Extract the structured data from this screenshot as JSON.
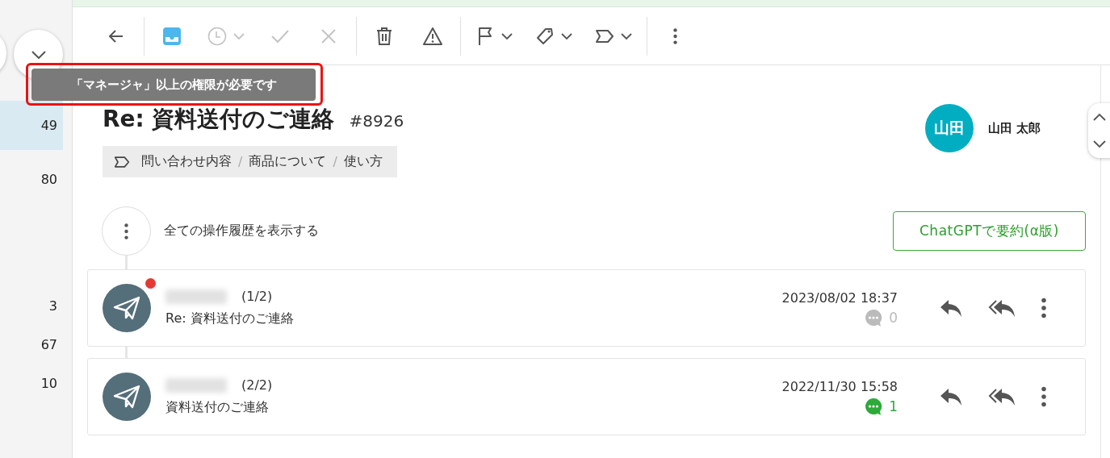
{
  "sidebar": {
    "items": [
      {
        "count": "49",
        "selected": true
      },
      {
        "count": "80",
        "selected": false
      },
      {
        "count": "3",
        "selected": false
      },
      {
        "count": "67",
        "selected": false
      },
      {
        "count": "10",
        "selected": false
      }
    ]
  },
  "toolbar": {
    "groups": [
      [
        {
          "kind": "back",
          "disabled": false,
          "selected": false,
          "dropdown": false
        }
      ],
      [
        {
          "kind": "inbox",
          "disabled": false,
          "selected": true,
          "dropdown": false
        },
        {
          "kind": "clock",
          "disabled": true,
          "selected": false,
          "dropdown": true
        },
        {
          "kind": "check",
          "disabled": true,
          "selected": false,
          "dropdown": false
        },
        {
          "kind": "close",
          "disabled": true,
          "selected": false,
          "dropdown": false
        }
      ],
      [
        {
          "kind": "trash",
          "disabled": false,
          "selected": false,
          "dropdown": false
        },
        {
          "kind": "warning",
          "disabled": false,
          "selected": false,
          "dropdown": false
        }
      ],
      [
        {
          "kind": "flag",
          "disabled": false,
          "selected": false,
          "dropdown": true
        },
        {
          "kind": "tag",
          "disabled": false,
          "selected": false,
          "dropdown": true
        },
        {
          "kind": "label",
          "disabled": false,
          "selected": false,
          "dropdown": true
        }
      ],
      [
        {
          "kind": "more",
          "disabled": false,
          "selected": false,
          "dropdown": false
        }
      ]
    ]
  },
  "tooltip": {
    "text": "「マネージャ」以上の権限が必要です",
    "highlighted": true
  },
  "ticket": {
    "title": "Re: 資料送付のご連絡",
    "number": "#8926",
    "category": [
      {
        "kind": "segment",
        "text": "問い合わせ内容"
      },
      {
        "kind": "separator",
        "text": "/"
      },
      {
        "kind": "segment",
        "text": "商品について"
      },
      {
        "kind": "separator",
        "text": "/"
      },
      {
        "kind": "segment",
        "text": "使い方"
      }
    ],
    "assignee": {
      "initials": "山田",
      "name": "山田 太郎"
    }
  },
  "history_link": "全ての操作履歴を表示する",
  "summary_button": "ChatGPTで要約(α版)",
  "messages": [
    {
      "index": "(1/2)",
      "subject": "Re: 資料送付のご連絡",
      "date": "2023/08/02 18:37",
      "unread": true,
      "comments": {
        "count": "0",
        "color": "#bbbbbb"
      }
    },
    {
      "index": "(2/2)",
      "subject": "資料送付のご連絡",
      "date": "2022/11/30 15:58",
      "unread": false,
      "comments": {
        "count": "1",
        "color": "#2eaa3a"
      }
    }
  ]
}
